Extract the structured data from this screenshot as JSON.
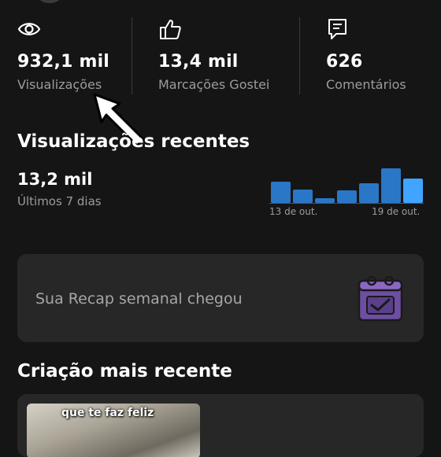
{
  "stats": [
    {
      "icon": "eye-icon",
      "value": "932,1 mil",
      "label": "Visualizações"
    },
    {
      "icon": "thumbs-up-icon",
      "value": "13,4 mil",
      "label": "Marcações Gostei"
    },
    {
      "icon": "comment-icon",
      "value": "626",
      "label": "Comentários"
    }
  ],
  "recent_views": {
    "title": "Visualizações recentes",
    "value": "13,2 mil",
    "period": "Últimos 7 dias",
    "start_label": "13 de out.",
    "end_label": "19 de out."
  },
  "chart_data": {
    "type": "bar",
    "categories": [
      "13 de out.",
      "",
      "",
      "",
      "",
      "",
      "19 de out."
    ],
    "values": [
      27,
      17,
      6,
      16,
      25,
      44,
      31
    ],
    "highlight_index": 6,
    "colors": {
      "bar": "#2a77c7",
      "highlight": "#41a4ff"
    }
  },
  "recap": {
    "text": "Sua Recap semanal chegou",
    "icon": "calendar-check-icon",
    "icon_color": "#6e4ea3"
  },
  "latest": {
    "title": "Criação mais recente",
    "thumb_caption": "que te faz feliz"
  },
  "colors": {
    "background": "#151515",
    "card": "#272727",
    "muted_text": "#9c9c9c"
  }
}
